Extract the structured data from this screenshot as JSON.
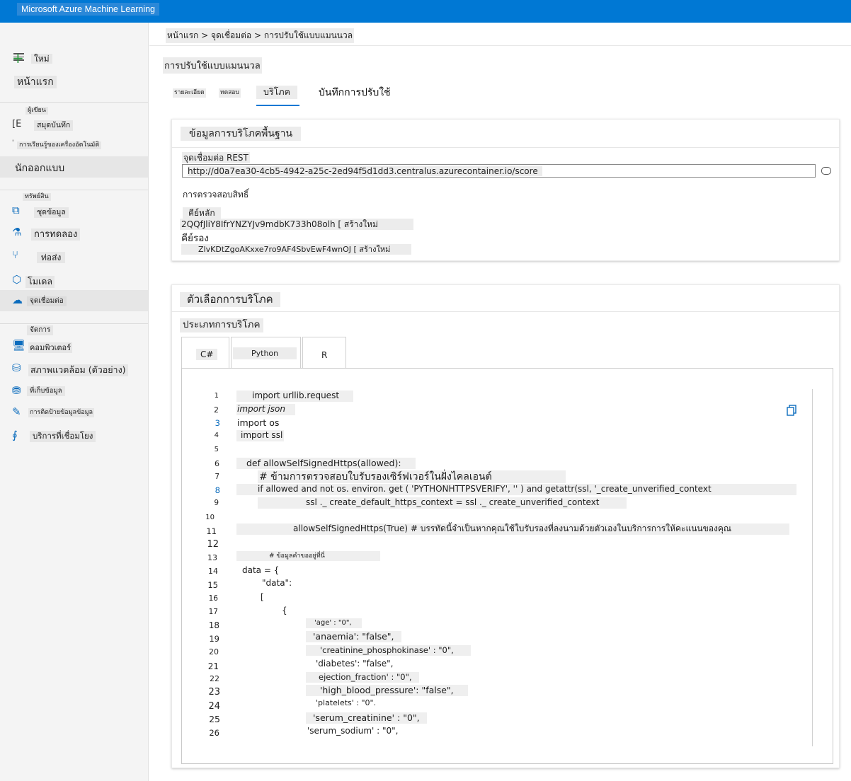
{
  "app": {
    "title": "Microsoft Azure Machine Learning"
  },
  "sidebar": {
    "new_label": "ใหม่",
    "home_label": "หน้าแรก",
    "author_section": "ผู้เขียน",
    "notebooks_label": "สมุดบันทึก",
    "automl_label": "การเรียนรู้ของเครื่องอัตโนมัติ",
    "designer_label": "นักออกแบบ",
    "assets_section": "ทรัพย์สิน",
    "datasets_label": "ชุดข้อมูล",
    "experiments_label": "การทดลอง",
    "pipelines_label": "ท่อส่ง",
    "models_label": "โมเดล",
    "endpoints_label": "จุดเชื่อมต่อ",
    "manage_section": "จัดการ",
    "compute_label": "คอมพิวเตอร์",
    "environments_label": "สภาพแวดล้อม (ตัวอย่าง)",
    "datastores_label": "ที่เก็บข้อมูล",
    "labeling_label": "การติดป้ายข้อมูลข้อมูล",
    "linked_services_label": "บริการที่เชื่อมโยง"
  },
  "breadcrumb": "หน้าแรก > จุดเชื่อมต่อ > การปรับใช้แบบแมนนวล",
  "page": {
    "title": "การปรับใช้แบบแมนนวล"
  },
  "tabs": {
    "details": "รายละเอียด",
    "test": "ทดสอบ",
    "consume": "บริโภค",
    "deploy_logs": "บันทึกการปรับใช้"
  },
  "basic_info": {
    "title": "ข้อมูลการบริโภคพื้นฐาน",
    "rest_label": "จุดเชื่อมต่อ REST",
    "rest_url": "http://d0a7ea30-4cb5-4942-a25c-2ed94f5d1dd3.centralus.azurecontainer.io/score",
    "auth_label": "การตรวจสอบสิทธิ์",
    "primary_label": "คีย์หลัก",
    "primary_key": "2QQfJliY8IfrYNZYJv9mdbK733h08olh [ สร้างใหม่",
    "secondary_label": "คีย์รอง",
    "secondary_key": "ZlvKDtZgoAKxxe7ro9AF4SbvEwF4wnOJ [ สร้างใหม่"
  },
  "consume_options": {
    "title": "ตัวเลือกการบริโภค",
    "type_label": "ประเภทการบริโภค",
    "lang_tabs": [
      "C#",
      "Python",
      "R"
    ]
  },
  "code": {
    "numbers": [
      "1",
      "2",
      "3",
      "4",
      "5",
      "6",
      "7",
      "8",
      "9",
      "10",
      "11",
      "12",
      "13",
      "14",
      "15",
      "16",
      "17",
      "18",
      "19",
      "20",
      "21",
      "22",
      "23",
      "24",
      "25",
      "26"
    ],
    "lines": [
      "import urllib.request",
      "import json",
      "import os",
      "import ssl",
      "",
      "def allowSelfSignedHttps(allowed):",
      "# ข้ามการตรวจสอบใบรับรองเซิร์ฟเวอร์ในฝั่งไคลเอนต์",
      "if allowed and not os. environ. get ( 'PYTHONHTTPSVERIFY', '' ) and getattr(ssl, '_create_unverified_context",
      "ssl ._ create_default_https_context = ssl ._ create_unverified_context",
      "",
      "allowSelfSignedHttps(True) # บรรทัดนี้จำเป็นหากคุณใช้ใบรับรองที่ลงนามด้วยตัวเองในบริการการให้คะแนนของคุณ",
      "",
      "# ข้อมูลคำขออยู่ที่นี่",
      "data = {",
      "\"data\":",
      "[",
      "{",
      "'age' : \"0\",",
      "'anaemia': \"false\",",
      "'creatinine_phosphokinase' : \"0\",",
      "'diabetes': \"false\",",
      "ejection_fraction' : \"0\",",
      "'high_blood_pressure': \"false\",",
      "'platelets' : \"0\".",
      "'serum_creatinine' : \"0\",",
      "'serum_sodium' : \"0\","
    ]
  },
  "colors": {
    "accent": "#0078d4",
    "icon": "#0b6cbd"
  }
}
